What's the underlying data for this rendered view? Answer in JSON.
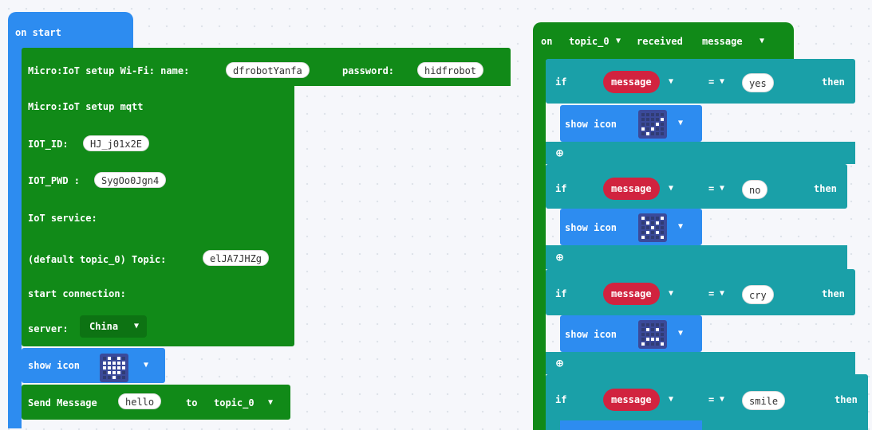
{
  "left": {
    "hat_label": "on start",
    "wifi": {
      "label": "Micro:IoT setup Wi-Fi: name:",
      "ssid": "dfrobotYanfa",
      "pass_label": "password:",
      "password": "hidfrobot"
    },
    "mqtt_label": "Micro:IoT setup mqtt",
    "iot_id_label": "IOT_ID:",
    "iot_id": "HJ_j01x2E",
    "iot_pwd_label": "IOT_PWD :",
    "iot_pwd": "SygOo0Jgn4",
    "service_label": "IoT service:",
    "topic_label": "(default topic_0) Topic:",
    "topic_value": "elJA7JHZg",
    "start_label": "start connection:",
    "server_label": "server:",
    "server_value": "China",
    "show_icon_label": "show icon",
    "send_label": "Send Message",
    "send_value": "hello",
    "to_label": "to",
    "to_value": "topic_0"
  },
  "right": {
    "hat_on": "on",
    "hat_topic": "topic_0",
    "hat_received": "received",
    "hat_message": "message",
    "if_label": "if",
    "then_label": "then",
    "var_label": "message",
    "op_label": "=",
    "show_icon_label": "show icon",
    "conditions": [
      {
        "value": "yes"
      },
      {
        "value": "no"
      },
      {
        "value": "cry"
      },
      {
        "value": "smile"
      }
    ]
  },
  "colors": {
    "green": "#118a18",
    "teal": "#1aa0a8",
    "blue": "#2d8cf0",
    "red": "#d1233f"
  },
  "icons": {
    "dropdown": "chevron-down-icon",
    "plus": "plus-circle-icon"
  }
}
